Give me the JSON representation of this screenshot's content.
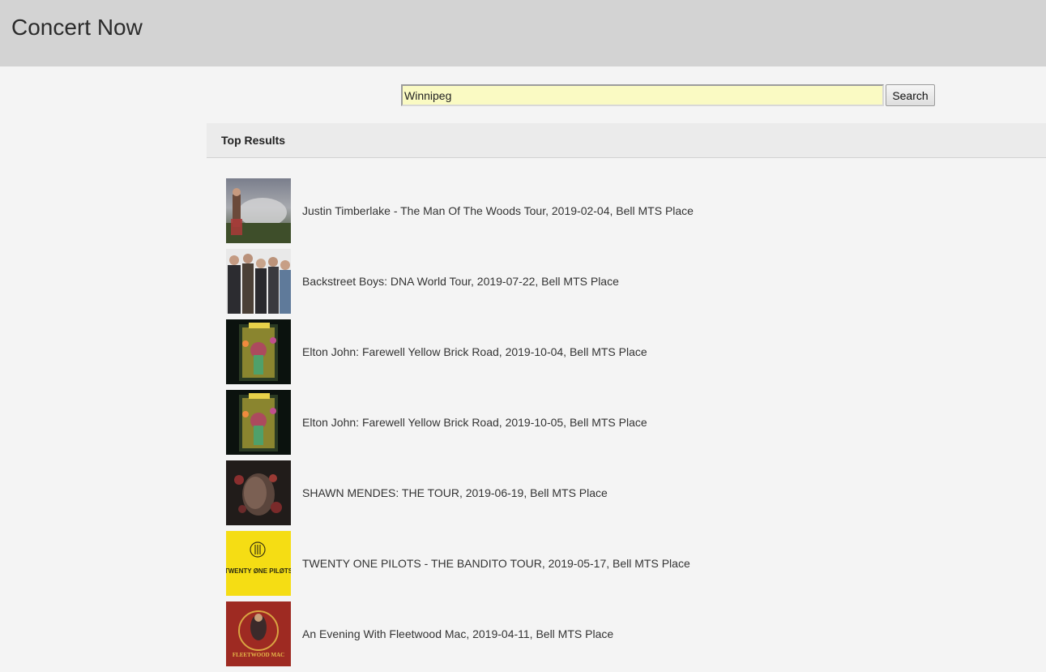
{
  "header": {
    "title": "Concert Now"
  },
  "search": {
    "value": "Winnipeg",
    "button_label": "Search"
  },
  "results": {
    "heading": "Top Results",
    "items": [
      {
        "text": "Justin Timberlake - The Man Of The Woods Tour, 2019-02-04, Bell MTS Place"
      },
      {
        "text": "Backstreet Boys: DNA World Tour, 2019-07-22, Bell MTS Place"
      },
      {
        "text": "Elton John: Farewell Yellow Brick Road, 2019-10-04, Bell MTS Place"
      },
      {
        "text": "Elton John: Farewell Yellow Brick Road, 2019-10-05, Bell MTS Place"
      },
      {
        "text": "SHAWN MENDES: THE TOUR, 2019-06-19, Bell MTS Place"
      },
      {
        "text": "TWENTY ONE PILOTS - THE BANDITO TOUR, 2019-05-17, Bell MTS Place",
        "thumb_label": "TWENTY ØNE PILØTS"
      },
      {
        "text": "An Evening With Fleetwood Mac, 2019-04-11, Bell MTS Place",
        "thumb_label": "FLEETWOOD MAC"
      }
    ]
  },
  "colors": {
    "header_bg": "#d3d3d3",
    "page_bg": "#f4f4f4",
    "input_bg": "#fafac3",
    "results_header_bg": "#ebebeb"
  }
}
